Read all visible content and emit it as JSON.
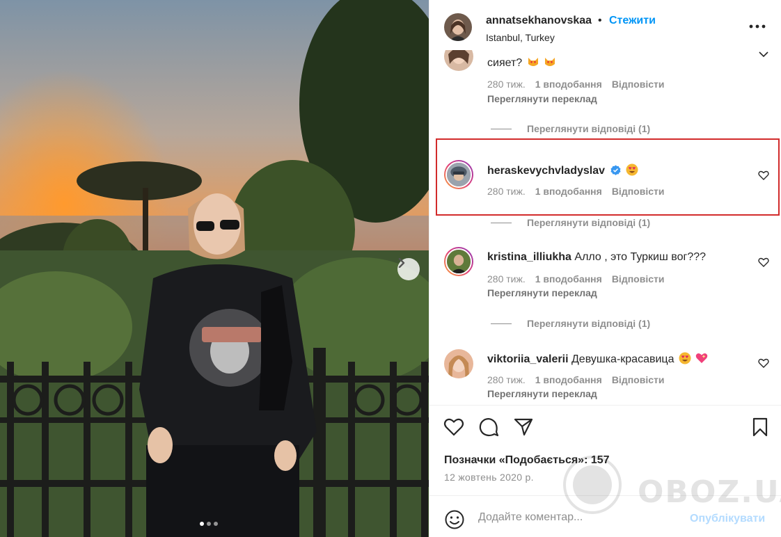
{
  "post": {
    "username": "annatsekhanovskaa",
    "separator": "•",
    "follow_label": "Стежити",
    "location": "Istanbul, Turkey",
    "more_icon": "more-horizontal-icon"
  },
  "photo": {
    "slide_count": 3,
    "active_slide": 1
  },
  "comments": [
    {
      "username": "",
      "text": "сияет?",
      "emoji": [
        "heart-eyes-cat-icon",
        "heart-eyes-cat-icon"
      ],
      "time": "280 тиж.",
      "likes": "1 вподобання",
      "reply": "Відповісти",
      "translate": "Переглянути переклад",
      "view_replies": "Переглянути відповіді (1)"
    },
    {
      "username": "heraskevychvladyslav",
      "verified": true,
      "text": "",
      "emoji": [
        "heart-eyes-icon"
      ],
      "time": "280 тиж.",
      "likes": "1 вподобання",
      "reply": "Відповісти",
      "view_replies": "Переглянути відповіді (1)"
    },
    {
      "username": "kristina_illiukha",
      "text": "Алло , это Туркиш вог???",
      "time": "280 тиж.",
      "likes": "1 вподобання",
      "reply": "Відповісти",
      "translate": "Переглянути переклад",
      "view_replies": "Переглянути відповіді (1)"
    },
    {
      "username": "viktoriia_valerii",
      "text": "Девушка-красавица",
      "emoji": [
        "heart-eyes-icon",
        "sparkling-heart-icon"
      ],
      "time": "280 тиж.",
      "likes": "1 вподобання",
      "reply": "Відповісти",
      "translate": "Переглянути переклад"
    }
  ],
  "actions": {
    "likes_text": "Позначки «Подобається»: 157",
    "date": "12 жовтень 2020 р."
  },
  "composer": {
    "placeholder": "Додайте коментар...",
    "publish_label": "Опублікувати"
  },
  "watermark": {
    "text": "OBOZ.UA"
  },
  "colors": {
    "accent": "#0095f6",
    "highlight_box": "#d22b2b",
    "muted": "#8e8e8e"
  }
}
